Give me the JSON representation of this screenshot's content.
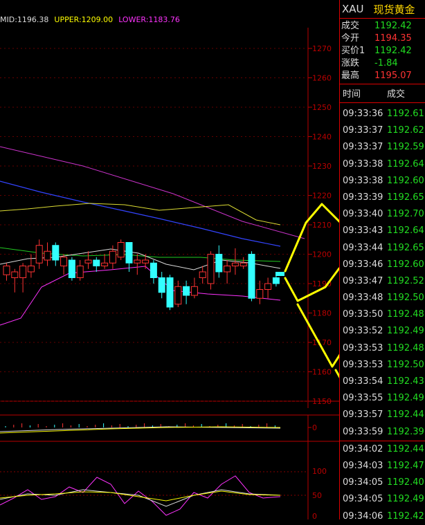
{
  "legend": {
    "mid": "MID:1196.38",
    "upper": "UPPER:1209.00",
    "lower": "LOWER:1183.76",
    "mid_color": "#dddddd",
    "upper_color": "#ffff00",
    "lower_color": "#ff33ff"
  },
  "price_axis": {
    "labels": [
      "1270",
      "1260",
      "1250",
      "1240",
      "1230",
      "1220",
      "1210",
      "1200",
      "1190",
      "1180",
      "1170",
      "1160",
      "1150"
    ]
  },
  "macd_axis": {
    "labels": [
      "0"
    ]
  },
  "osc_axis": {
    "labels": [
      "100",
      "50",
      "0"
    ]
  },
  "header": {
    "symbol": "XAU",
    "name": "现货黄金"
  },
  "quote": [
    {
      "label": "成交",
      "value": "1192.42",
      "color": "#22dd22"
    },
    {
      "label": "今开",
      "value": "1194.35",
      "color": "#ff3333"
    },
    {
      "label": "买价1",
      "value": "1192.42",
      "color": "#22dd22"
    },
    {
      "label": "涨跌",
      "value": "-1.84",
      "color": "#22dd22"
    },
    {
      "label": "最高",
      "value": "1195.07",
      "color": "#ff3333"
    }
  ],
  "trade_header": {
    "time": "时间",
    "price": "成交"
  },
  "trades": [
    {
      "time": "09:33:36",
      "price": "1192.61"
    },
    {
      "time": "09:33:37",
      "price": "1192.62"
    },
    {
      "time": "09:33:37",
      "price": "1192.59"
    },
    {
      "time": "09:33:38",
      "price": "1192.64"
    },
    {
      "time": "09:33:38",
      "price": "1192.60"
    },
    {
      "time": "09:33:39",
      "price": "1192.65"
    },
    {
      "time": "09:33:40",
      "price": "1192.70"
    },
    {
      "time": "09:33:43",
      "price": "1192.64"
    },
    {
      "time": "09:33:44",
      "price": "1192.65"
    },
    {
      "time": "09:33:46",
      "price": "1192.60"
    },
    {
      "time": "09:33:47",
      "price": "1192.52"
    },
    {
      "time": "09:33:48",
      "price": "1192.50"
    },
    {
      "time": "09:33:50",
      "price": "1192.48"
    },
    {
      "time": "09:33:52",
      "price": "1192.49"
    },
    {
      "time": "09:33:53",
      "price": "1192.48"
    },
    {
      "time": "09:33:53",
      "price": "1192.50"
    },
    {
      "time": "09:33:54",
      "price": "1192.43"
    },
    {
      "time": "09:33:55",
      "price": "1192.49"
    },
    {
      "time": "09:33:57",
      "price": "1192.44"
    },
    {
      "time": "09:33:59",
      "price": "1192.39"
    },
    {
      "time": "09:34:02",
      "price": "1192.44"
    },
    {
      "time": "09:34:03",
      "price": "1192.47"
    },
    {
      "time": "09:34:05",
      "price": "1192.40"
    },
    {
      "time": "09:34:05",
      "price": "1192.49"
    },
    {
      "time": "09:34:06",
      "price": "1192.42"
    }
  ],
  "candles": [
    {
      "o": 1193,
      "c": 1196,
      "h": 1197,
      "l": 1191,
      "color": "up"
    },
    {
      "o": 1194,
      "c": 1192,
      "h": 1195,
      "l": 1187,
      "color": "up"
    },
    {
      "o": 1192,
      "c": 1196,
      "h": 1197,
      "l": 1187,
      "color": "up"
    },
    {
      "o": 1196,
      "c": 1194,
      "h": 1200,
      "l": 1192,
      "color": "up"
    },
    {
      "o": 1197,
      "c": 1203,
      "h": 1205,
      "l": 1195,
      "color": "up"
    },
    {
      "o": 1198,
      "c": 1201,
      "h": 1204,
      "l": 1196,
      "color": "up"
    },
    {
      "o": 1203,
      "c": 1198,
      "h": 1204,
      "l": 1196,
      "color": "down"
    },
    {
      "o": 1196,
      "c": 1199,
      "h": 1200,
      "l": 1193,
      "color": "up"
    },
    {
      "o": 1198,
      "c": 1192,
      "h": 1199,
      "l": 1191,
      "color": "down"
    },
    {
      "o": 1192,
      "c": 1196,
      "h": 1198,
      "l": 1191,
      "color": "up"
    },
    {
      "o": 1197,
      "c": 1198,
      "h": 1201,
      "l": 1195,
      "color": "up"
    },
    {
      "o": 1198,
      "c": 1196,
      "h": 1199,
      "l": 1194,
      "color": "down"
    },
    {
      "o": 1196,
      "c": 1197,
      "h": 1200,
      "l": 1195,
      "color": "up"
    },
    {
      "o": 1197,
      "c": 1201,
      "h": 1203,
      "l": 1195,
      "color": "up"
    },
    {
      "o": 1199,
      "c": 1204,
      "h": 1205,
      "l": 1198,
      "color": "up"
    },
    {
      "o": 1204,
      "c": 1197,
      "h": 1204,
      "l": 1194,
      "color": "down"
    },
    {
      "o": 1197,
      "c": 1198,
      "h": 1200,
      "l": 1193,
      "color": "up"
    },
    {
      "o": 1198,
      "c": 1197,
      "h": 1200,
      "l": 1195,
      "color": "up"
    },
    {
      "o": 1197,
      "c": 1192,
      "h": 1198,
      "l": 1190,
      "color": "down"
    },
    {
      "o": 1192,
      "c": 1187,
      "h": 1194,
      "l": 1185,
      "color": "down"
    },
    {
      "o": 1192,
      "c": 1182,
      "h": 1193,
      "l": 1181,
      "color": "down"
    },
    {
      "o": 1183,
      "c": 1189,
      "h": 1191,
      "l": 1182,
      "color": "up"
    },
    {
      "o": 1189,
      "c": 1186,
      "h": 1191,
      "l": 1183,
      "color": "down"
    },
    {
      "o": 1186,
      "c": 1189,
      "h": 1192,
      "l": 1185,
      "color": "up"
    },
    {
      "o": 1192,
      "c": 1194,
      "h": 1196,
      "l": 1190,
      "color": "up"
    },
    {
      "o": 1190,
      "c": 1200,
      "h": 1201,
      "l": 1188,
      "color": "up"
    },
    {
      "o": 1200,
      "c": 1194,
      "h": 1203,
      "l": 1192,
      "color": "down"
    },
    {
      "o": 1194,
      "c": 1196,
      "h": 1198,
      "l": 1190,
      "color": "up"
    },
    {
      "o": 1196,
      "c": 1197,
      "h": 1202,
      "l": 1193,
      "color": "up"
    },
    {
      "o": 1197,
      "c": 1196,
      "h": 1199,
      "l": 1195,
      "color": "up"
    },
    {
      "o": 1200,
      "c": 1185,
      "h": 1201,
      "l": 1184,
      "color": "down"
    },
    {
      "o": 1185,
      "c": 1188,
      "h": 1191,
      "l": 1183,
      "color": "up"
    },
    {
      "o": 1188,
      "c": 1190,
      "h": 1192,
      "l": 1185,
      "color": "up"
    },
    {
      "o": 1192,
      "c": 1190,
      "h": 1193,
      "l": 1189,
      "color": "down"
    }
  ]
}
